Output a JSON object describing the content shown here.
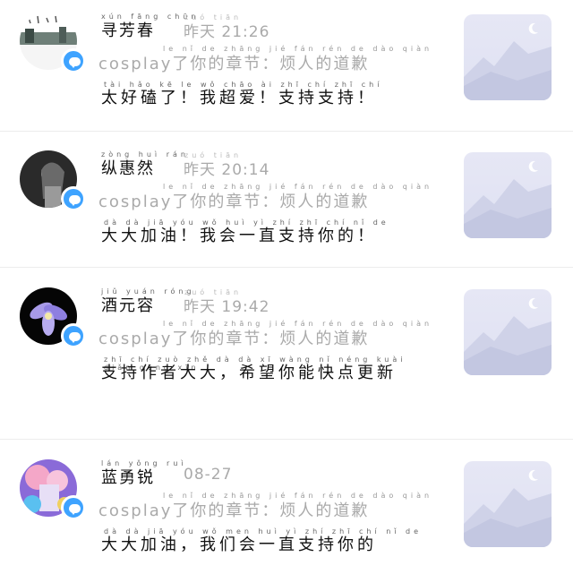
{
  "comments": [
    {
      "name": "寻芳春",
      "name_pinyin": "xún fāng chūn",
      "time": "21:26",
      "time_prefix": "昨天",
      "time_prefix_pinyin": "zuó tiān",
      "subtitle": "cosplay了你的章节：烦人的道歉",
      "subtitle_pinyin": "le nǐ de zhāng jié   fán rén de dào qiàn",
      "text": "太好磕了！我超爱！支持支持！",
      "text_pinyin": "tài hǎo kē le   wǒ chāo ài   zhī chí zhī chí"
    },
    {
      "name": "纵惠然",
      "name_pinyin": "zòng huì rán",
      "time": "20:14",
      "time_prefix": "昨天",
      "time_prefix_pinyin": "zuó tiān",
      "subtitle": "cosplay了你的章节：烦人的道歉",
      "subtitle_pinyin": "le nǐ de zhāng jié   fán rén de dào qiàn",
      "text": "大大加油！我会一直支持你的！",
      "text_pinyin": "dà dà jiā yóu   wǒ huì yì zhí zhī chí nǐ de"
    },
    {
      "name": "酒元容",
      "name_pinyin": "jiǔ yuán róng",
      "time": "19:42",
      "time_prefix": "昨天",
      "time_prefix_pinyin": "zuó tiān",
      "subtitle": "cosplay了你的章节：烦人的道歉",
      "subtitle_pinyin": "le nǐ de zhāng jié   fán rén de dào qiàn",
      "text": "支持作者大大，希望你能快点更新",
      "text_pinyin": "zhī chí zuò zhě dà dà   xī wàng nǐ néng kuài diǎn gēng xīn"
    },
    {
      "name": "蓝勇锐",
      "name_pinyin": "lán yǒng ruì",
      "time": "08-27",
      "time_prefix": "",
      "time_prefix_pinyin": "",
      "subtitle": "cosplay了你的章节：烦人的道歉",
      "subtitle_pinyin": "le nǐ de zhāng jié   fán rén de dào qiàn",
      "text": "大大加油，我们会一直支持你的",
      "text_pinyin": "dà dà jiā yóu   wǒ men huì yì zhí zhī chí nǐ de"
    }
  ],
  "colors": {
    "badge": "#3ea3ff",
    "muted": "#aaaaaa",
    "thumb_bg": "#e3e5f4",
    "thumb_mountain": "#c8cbe3"
  },
  "icons": {
    "badge": "chat-bubble-icon",
    "thumb": "landscape-placeholder-icon"
  }
}
